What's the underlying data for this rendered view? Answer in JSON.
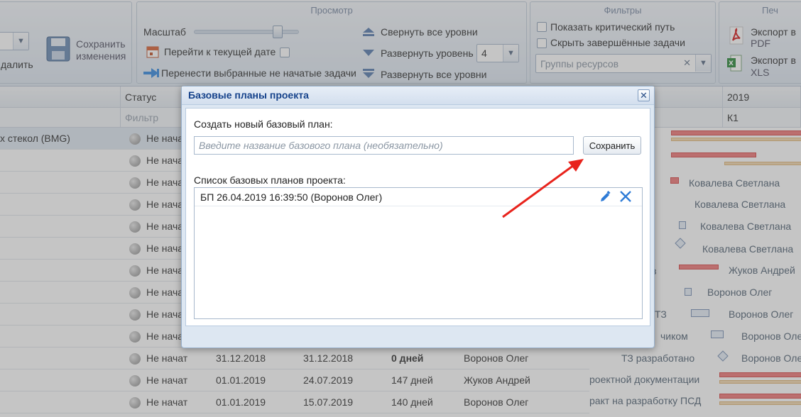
{
  "ribbon": {
    "left_group": {
      "delete_label": "далить",
      "save_line1": "Сохранить",
      "save_line2": "изменения"
    },
    "view_group": {
      "title": "Просмотр",
      "scale_label": "Масштаб",
      "scale_level": 0.8,
      "goto_today": "Перейти к текущей дате",
      "move_tasks": "Перенести выбранные не начатые задачи",
      "collapse_all": "Свернуть все уровни",
      "expand_level": "Развернуть уровень",
      "expand_level_value": "4",
      "expand_all": "Развернуть все уровни"
    },
    "filters_group": {
      "title": "Фильтры",
      "show_critical": "Показать критический путь",
      "hide_completed": "Скрыть завершённые задачи",
      "resource_groups_placeholder": "Группы ресурсов"
    },
    "print_group": {
      "title": "Печ",
      "export_pdf_1": "Экспорт в",
      "export_pdf_2": "PDF",
      "export_xls_1": "Экспорт в",
      "export_xls_2": "XLS"
    }
  },
  "grid": {
    "status_header": "Статус",
    "filter_placeholder": "Фильтр",
    "year_header": "2019",
    "quarter_header": "К1",
    "rows": [
      {
        "name": "х стекол (BMG)",
        "status": "Не начат",
        "start": "",
        "end": "",
        "duration": "",
        "owner": "",
        "selected": true
      },
      {
        "name": "",
        "status": "Не начат",
        "start": "",
        "end": "",
        "duration": "",
        "owner": ""
      },
      {
        "name": "",
        "status": "Не начат",
        "start": "",
        "end": "",
        "duration": "",
        "owner": ""
      },
      {
        "name": "",
        "status": "Не начат",
        "start": "",
        "end": "",
        "duration": "",
        "owner": ""
      },
      {
        "name": "",
        "status": "Не начат",
        "start": "",
        "end": "",
        "duration": "",
        "owner": ""
      },
      {
        "name": "",
        "status": "Не начат",
        "start": "",
        "end": "",
        "duration": "",
        "owner": ""
      },
      {
        "name": "",
        "status": "Не начат",
        "start": "",
        "end": "",
        "duration": "",
        "owner": ""
      },
      {
        "name": "",
        "status": "Не начат",
        "start": "",
        "end": "",
        "duration": "",
        "owner": ""
      },
      {
        "name": "",
        "status": "Не начат",
        "start": "",
        "end": "",
        "duration": "",
        "owner": ""
      },
      {
        "name": "",
        "status": "Не начат",
        "start": "",
        "end": "",
        "duration": "",
        "owner": ""
      },
      {
        "name": "",
        "status": "Не начат",
        "start": "31.12.2018",
        "end": "31.12.2018",
        "duration": "0 дней",
        "owner": "Воронов Олег",
        "bold_duration": true
      },
      {
        "name": "",
        "status": "Не начат",
        "start": "01.01.2019",
        "end": "24.07.2019",
        "duration": "147 дней",
        "owner": "Жуков Андрей"
      },
      {
        "name": "",
        "status": "Не начат",
        "start": "01.01.2019",
        "end": "15.07.2019",
        "duration": "140 дней",
        "owner": "Воронов Олег"
      }
    ],
    "gantt_labels": [
      "Ковалева Светлана",
      "Ковалева Светлана",
      "Ковалева Светлана",
      "Ковалева Светлана",
      "Жуков Андрей",
      "Воронов Олег",
      "Воронов Олег",
      "Воронов Оле",
      "Воронов Оле",
      "чиком",
      "ТЗ разработано",
      "роектной документации",
      "ракт на разработку ПСД",
      "з",
      "ТЗ"
    ]
  },
  "dialog": {
    "title": "Базовые планы проекта",
    "create_label": "Создать новый базовый план:",
    "name_placeholder": "Введите название базового плана (необязательно)",
    "save_button": "Сохранить",
    "list_label": "Список базовых планов проекта:",
    "plans": [
      {
        "label": "БП 26.04.2019 16:39:50 (Воронов Олег)"
      }
    ]
  },
  "colors": {
    "accent": "#15428b",
    "gantt_red": "#f07b7b",
    "arrow": "#e8231c"
  }
}
